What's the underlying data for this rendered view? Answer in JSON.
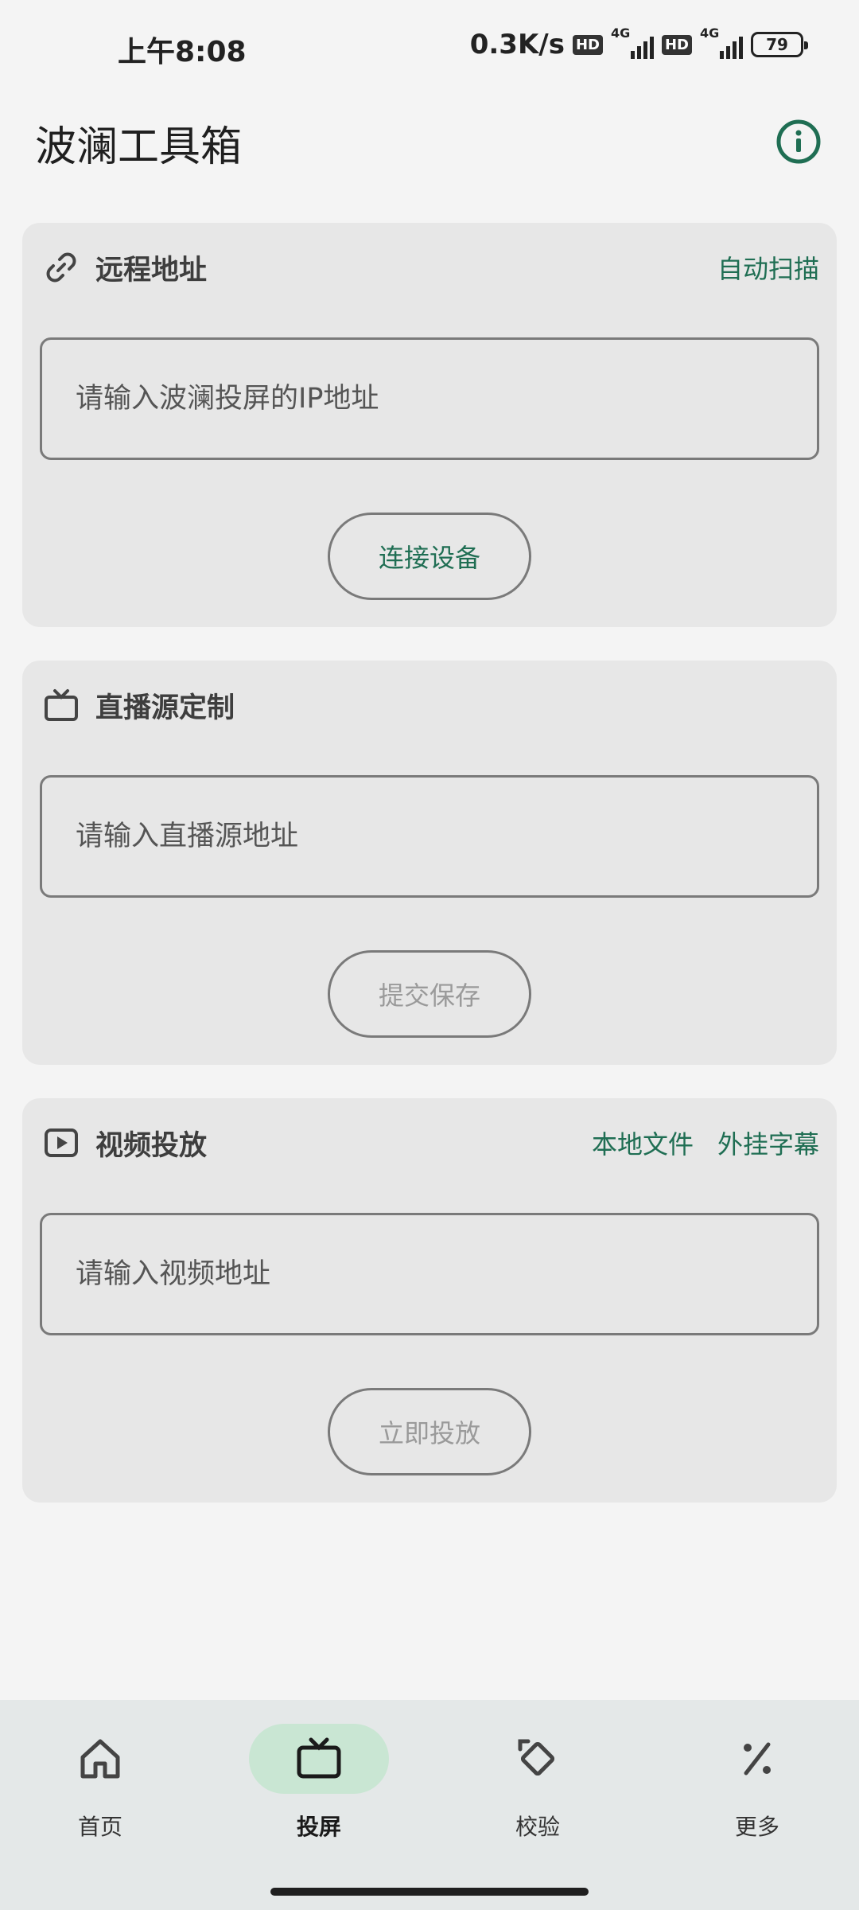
{
  "status_bar": {
    "time": "上午8:08",
    "net_speed": "0.3K/s",
    "hd_label": "HD",
    "signal_label": "4G",
    "battery": "79"
  },
  "app": {
    "title": "波澜工具箱"
  },
  "cards": {
    "remote": {
      "title": "远程地址",
      "action": "自动扫描",
      "placeholder": "请输入波澜投屏的IP地址",
      "button": "连接设备"
    },
    "live": {
      "title": "直播源定制",
      "placeholder": "请输入直播源地址",
      "button": "提交保存"
    },
    "video": {
      "title": "视频投放",
      "action_local": "本地文件",
      "action_subtitle": "外挂字幕",
      "placeholder": "请输入视频地址",
      "button": "立即投放"
    }
  },
  "nav": {
    "items": [
      {
        "label": "首页",
        "icon": "home-icon"
      },
      {
        "label": "投屏",
        "icon": "tv-icon"
      },
      {
        "label": "校验",
        "icon": "rotate-icon"
      },
      {
        "label": "更多",
        "icon": "percent-icon"
      }
    ],
    "active_index": 1
  },
  "colors": {
    "accent": "#1f6e53",
    "card_bg": "#e7e7e7",
    "nav_bg": "#e4e8e8",
    "nav_active_pill": "#c9e6d3"
  }
}
